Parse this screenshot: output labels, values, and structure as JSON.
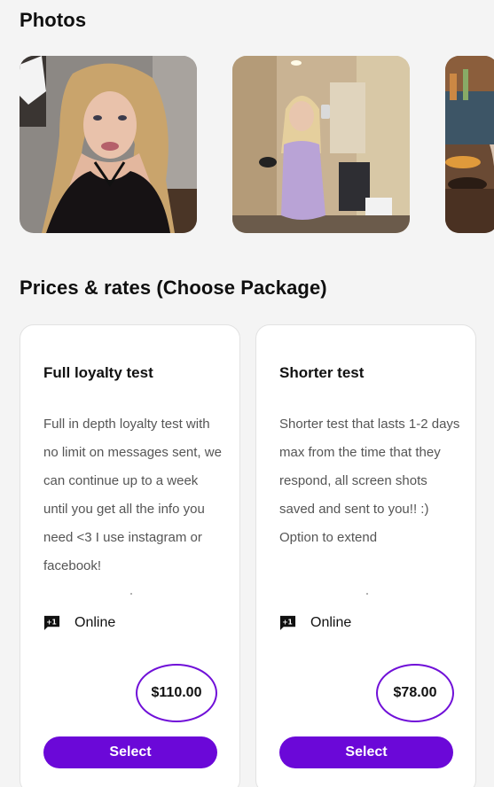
{
  "photos_section": {
    "title": "Photos",
    "items": [
      {
        "icon": "photo-blonde-selfie"
      },
      {
        "icon": "photo-mirror-selfie-lilac-dress"
      },
      {
        "icon": "photo-bar-interior"
      }
    ]
  },
  "prices_section": {
    "title": "Prices & rates (Choose Package)",
    "packages": [
      {
        "title": "Full loyalty test",
        "description": "Full in depth loyalty test with no limit on messages sent, we can continue up to a week until you get all the info you need <3 I use instagram or facebook!",
        "mode_icon": "message-plus-one-icon",
        "mode": "Online",
        "price": "$110.00",
        "button": "Select"
      },
      {
        "title": "Shorter test",
        "description": "Shorter test that lasts 1-2 days max from the time that they respond, all screen shots saved and sent to you!! :) Option to extend",
        "mode_icon": "message-plus-one-icon",
        "mode": "Online",
        "price": "$78.00",
        "button": "Select"
      }
    ]
  },
  "colors": {
    "accent": "#6b08d8",
    "price_ring": "#7010d8",
    "background": "#f4f4f4",
    "card": "#ffffff"
  }
}
